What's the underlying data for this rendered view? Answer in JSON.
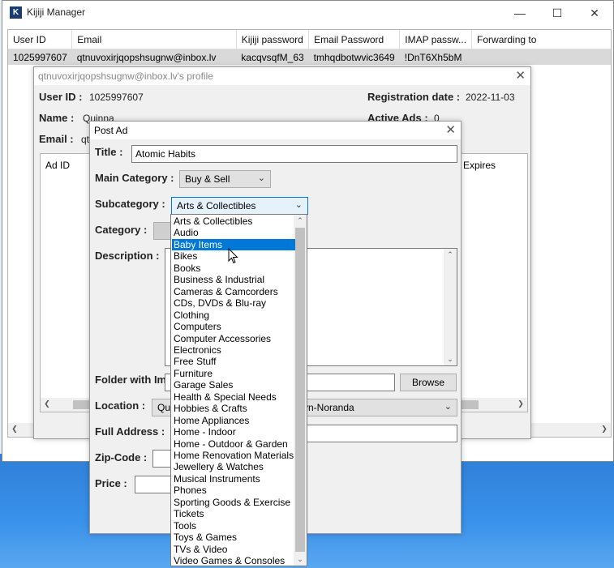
{
  "app": {
    "title": "Kijiji Manager",
    "columns": [
      "User ID",
      "Email",
      "Kijiji password",
      "Email Password",
      "IMAP passw...",
      "Forwarding to"
    ],
    "row": [
      "1025997607",
      "qtnuvoxirjqopshsugnw@inbox.lv",
      "kacqvsqfM_63",
      "tmhqdbotwvic3649",
      "!DnT6Xh5bM",
      ""
    ]
  },
  "profile": {
    "title": "qtnuvoxirjqopshsugnw@inbox.lv's profile",
    "user_id_label": "User ID :",
    "user_id": "1025997607",
    "reg_label": "Registration date :",
    "reg_date": "2022-11-03",
    "name_label": "Name :",
    "name": "Quinna",
    "active_label": "Active Ads :",
    "active": "0",
    "email_label": "Email :",
    "email_partial": "qt",
    "ad_id_col": "Ad ID",
    "expires_col": "Expires"
  },
  "post_ad": {
    "title": "Post Ad",
    "title_label": "Title :",
    "title_value": "Atomic Habits",
    "main_cat_label": "Main Category :",
    "main_cat_value": "Buy & Sell",
    "subcat_label": "Subcategory :",
    "subcat_value": "Arts & Collectibles",
    "category_label": "Category :",
    "description_label": "Description :",
    "folder_label": "Folder with Ima",
    "browse_label": "Browse",
    "location_label": "Location :",
    "location_value_left": "Qué",
    "location_value_right": "yn-Noranda",
    "address_label": "Full Address :",
    "zip_label": "Zip-Code :",
    "price_label": "Price :"
  },
  "subcategories": [
    "Arts & Collectibles",
    "Audio",
    "Baby Items",
    "Bikes",
    "Books",
    "Business & Industrial",
    "Cameras & Camcorders",
    "CDs, DVDs & Blu-ray",
    "Clothing",
    "Computers",
    "Computer Accessories",
    "Electronics",
    "Free Stuff",
    "Furniture",
    "Garage Sales",
    "Health & Special Needs",
    "Hobbies & Crafts",
    "Home Appliances",
    "Home - Indoor",
    "Home - Outdoor & Garden",
    "Home Renovation Materials",
    "Jewellery & Watches",
    "Musical Instruments",
    "Phones",
    "Sporting Goods & Exercise",
    "Tickets",
    "Tools",
    "Toys & Games",
    "TVs & Video",
    "Video Games & Consoles"
  ],
  "highlighted_item": "Baby Items",
  "colors": {
    "highlight": "#0078d7",
    "desktop": "#3d8fe0"
  },
  "icons": {
    "close": "close-icon",
    "minimize": "minimize-icon",
    "maximize": "maximize-icon",
    "dropdown": "chevron-down-icon"
  }
}
